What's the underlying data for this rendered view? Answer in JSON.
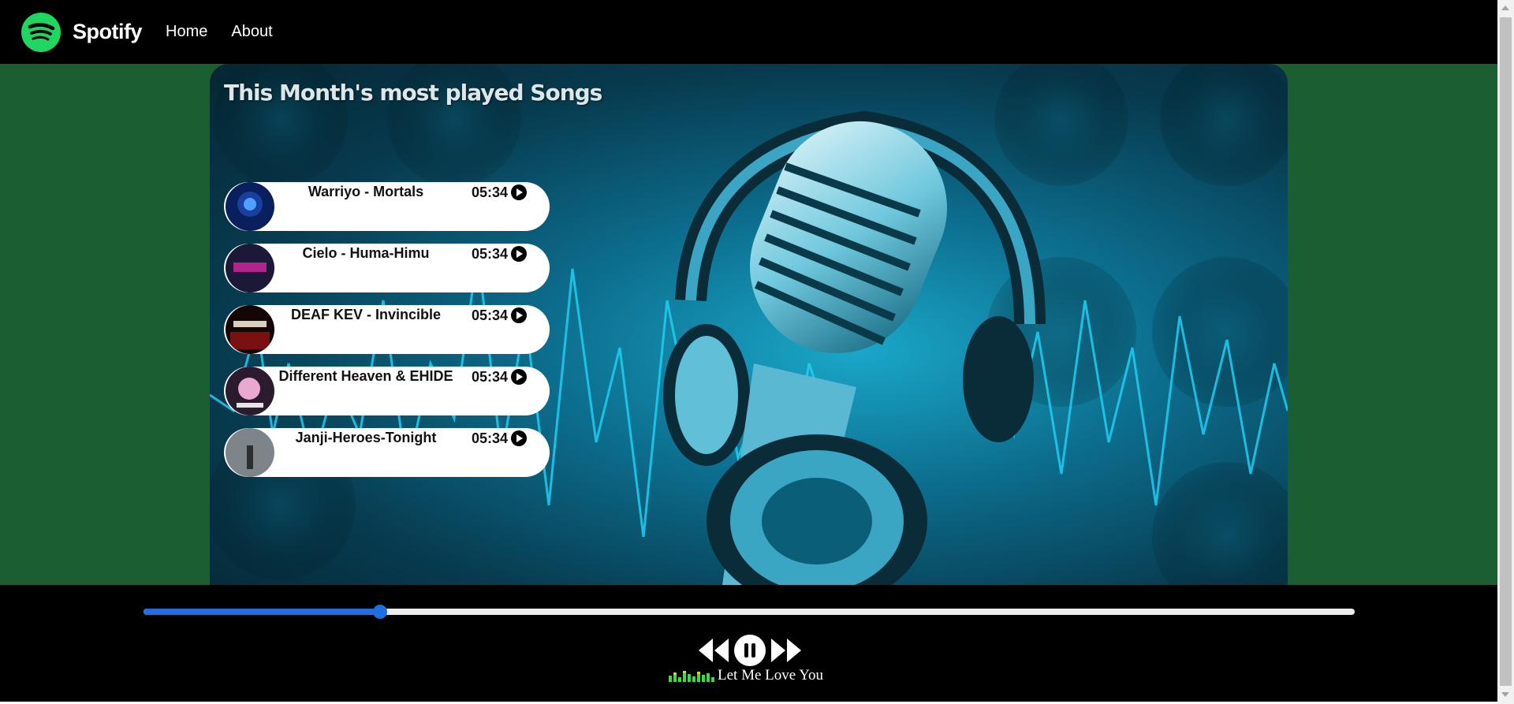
{
  "navbar": {
    "brand": "Spotify",
    "links": [
      "Home",
      "About"
    ],
    "logo_icon": "spotify-logo-icon",
    "logo_color": "#1ed760"
  },
  "main": {
    "title": "This Month's most played Songs",
    "background_color": "#1b5e31",
    "songs": [
      {
        "name": "Warriyo - Mortals",
        "duration": "05:34",
        "cover_color": "#1a3f9e"
      },
      {
        "name": "Cielo - Huma-Himu",
        "duration": "05:34",
        "cover_color": "#2a2450"
      },
      {
        "name": "DEAF KEV - Invincible",
        "duration": "05:34",
        "cover_color": "#5a0d0d"
      },
      {
        "name": "Different Heaven & EHIDE",
        "duration": "05:34",
        "cover_color": "#3a2040"
      },
      {
        "name": "Janji-Heroes-Tonight",
        "duration": "05:34",
        "cover_color": "#8a9096"
      }
    ]
  },
  "player": {
    "progress": 0.195,
    "progress_color": "#1f6fe0",
    "now_playing": "Let Me Love You",
    "controls": [
      "previous-icon",
      "pause-icon",
      "next-icon"
    ]
  }
}
